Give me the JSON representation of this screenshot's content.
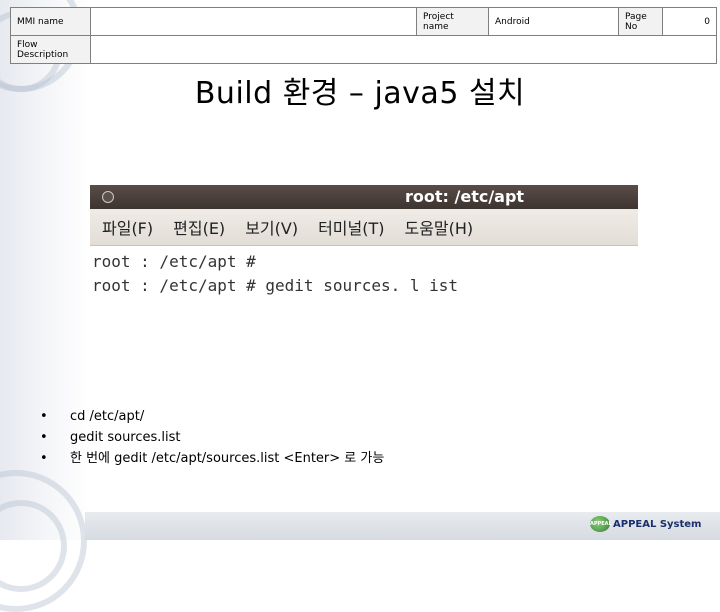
{
  "header": {
    "mmi_label": "MMI name",
    "mmi_value": "",
    "project_label": "Project name",
    "project_value": "Android",
    "page_label": "Page No",
    "page_value": "0",
    "flow_label": "Flow Description",
    "flow_value": ""
  },
  "title": "Build 환경 – java5 설치",
  "terminal": {
    "title": "root: /etc/apt",
    "menu": [
      "파일(F)",
      "편집(E)",
      "보기(V)",
      "터미널(T)",
      "도움말(H)"
    ],
    "lines": [
      "root : /etc/apt #",
      "root : /etc/apt #  gedit  sources. l ist"
    ]
  },
  "bullets": [
    "cd /etc/apt/",
    "gedit sources.list",
    "한 번에 gedit /etc/apt/sources.list <Enter> 로 가능"
  ],
  "footer": {
    "logo_text": "APPEAL",
    "brand": "APPEAL System"
  },
  "icons": {
    "window_control": "circle-button-icon",
    "logo": "appeal-logo-icon"
  },
  "colors": {
    "terminal_titlebar": "#3d3430",
    "terminal_menubar": "#e2ddd6",
    "brand": "#1a2f6b"
  }
}
